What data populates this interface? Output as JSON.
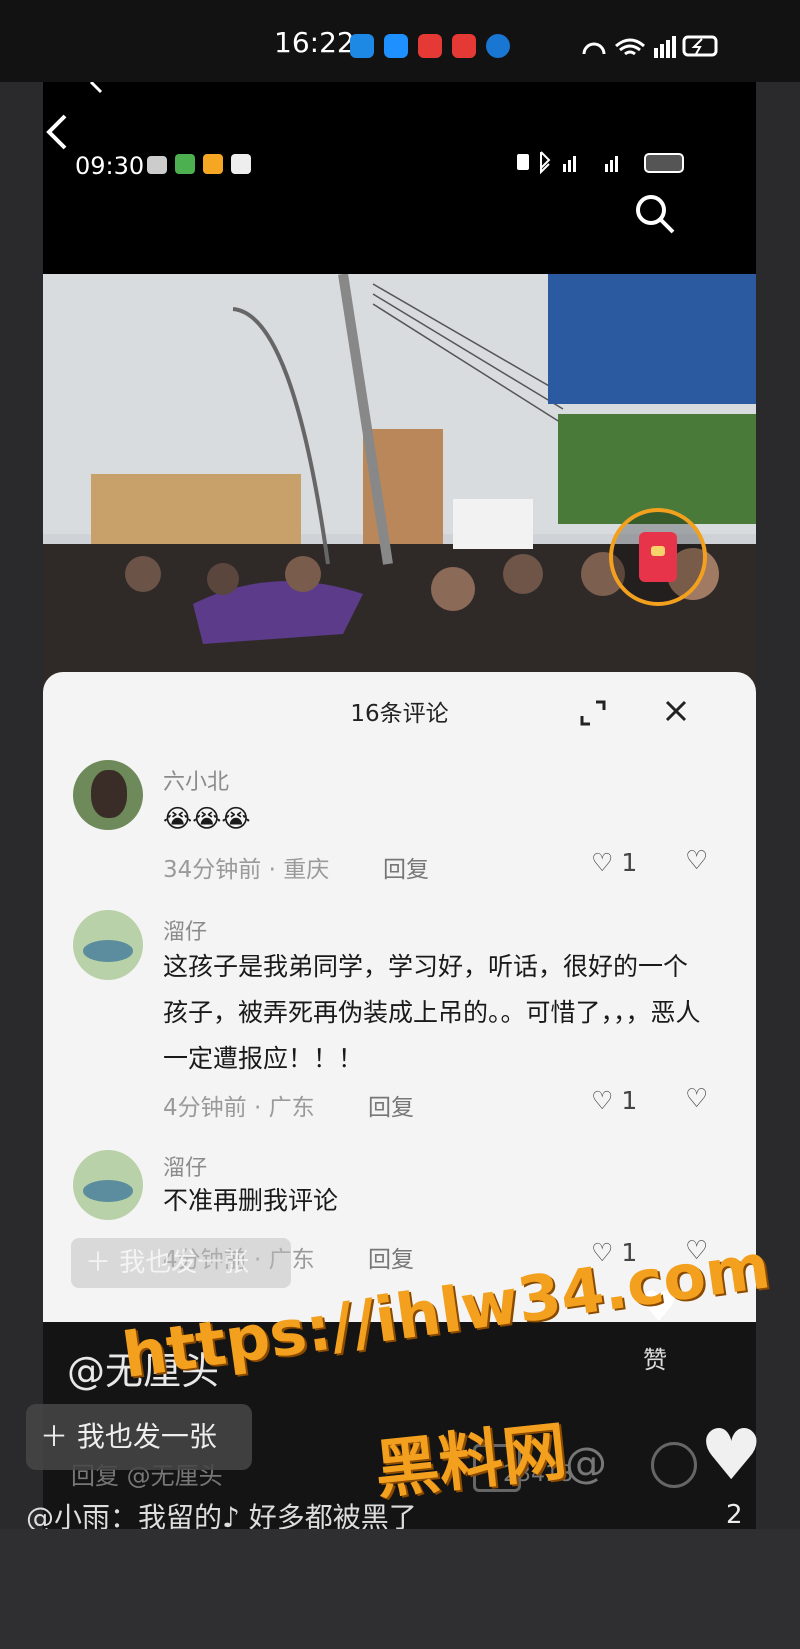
{
  "outer_status": {
    "time": "16:22"
  },
  "inner_status": {
    "time": "09:30"
  },
  "comments_panel": {
    "title": "16条评论",
    "comments": [
      {
        "name": "六小北",
        "text": "😭😭😭",
        "time": "34分钟前",
        "location": "重庆",
        "reply": "回复",
        "likes": "1"
      },
      {
        "name": "溜仔",
        "text": "这孩子是我弟同学，学习好，听话，很好的一个孩子，被弄死再伪装成上吊的。。可惜了，，，恶人一定遭报应！！！",
        "time": "4分钟前",
        "location": "广东",
        "reply": "回复",
        "likes": "1"
      },
      {
        "name": "溜仔",
        "text": "不准再删我评论",
        "time": "4分钟前",
        "location": "广东",
        "reply": "回复",
        "likes": "1"
      }
    ],
    "post_image_label": "我也发一张"
  },
  "feed": {
    "author": "@无厘头",
    "like_label": "赞",
    "post_button": "我也发一张",
    "reply_placeholder": "回复 @无厘头",
    "count_fragment": "23418",
    "heart_count": "2",
    "danmaku": "@小雨：我留的♪ 好多都被黑了"
  },
  "watermark": {
    "url": "https://ihlw34.com",
    "name": "黑料网"
  },
  "colors": {
    "watermark": "#f3a01f",
    "panel_bg": "#f4f4f4",
    "red_packet": "#e8344a"
  }
}
